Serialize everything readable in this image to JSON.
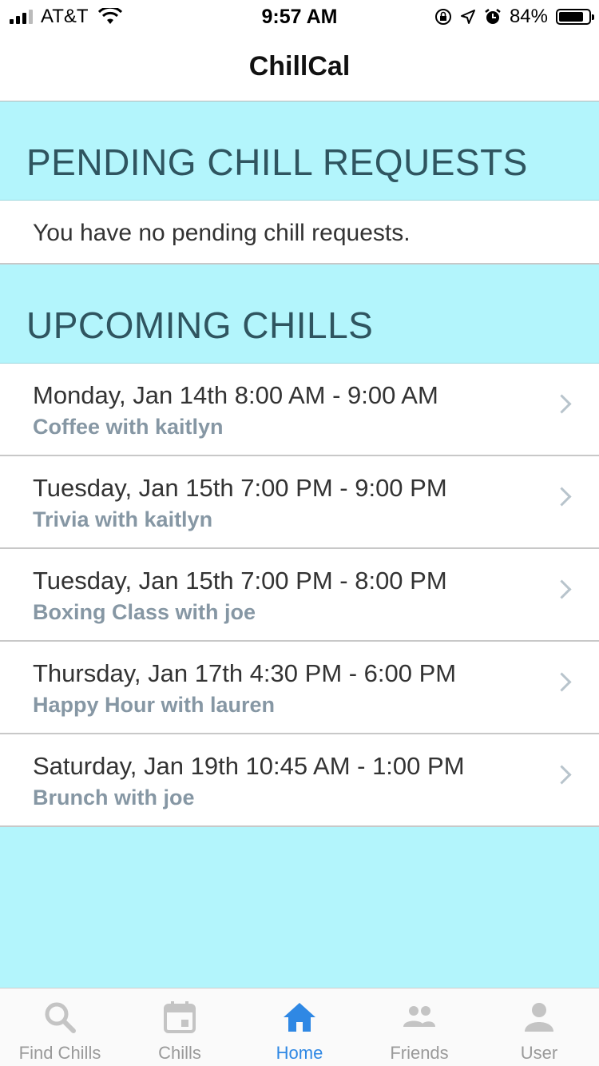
{
  "status": {
    "carrier": "AT&T",
    "time": "9:57 AM",
    "battery": "84%"
  },
  "nav": {
    "title": "ChillCal"
  },
  "pending": {
    "header": "PENDING CHILL REQUESTS",
    "empty_text": "You have no pending chill requests."
  },
  "upcoming": {
    "header": "UPCOMING CHILLS",
    "items": [
      {
        "when": "Monday, Jan 14th 8:00 AM - 9:00 AM",
        "what": "Coffee with kaitlyn"
      },
      {
        "when": "Tuesday, Jan 15th 7:00 PM - 9:00 PM",
        "what": "Trivia with kaitlyn"
      },
      {
        "when": "Tuesday, Jan 15th 7:00 PM - 8:00 PM",
        "what": "Boxing Class with joe"
      },
      {
        "when": "Thursday, Jan 17th 4:30 PM - 6:00 PM",
        "what": "Happy Hour with lauren"
      },
      {
        "when": "Saturday, Jan 19th 10:45 AM - 1:00 PM",
        "what": "Brunch with joe"
      }
    ]
  },
  "tabs": [
    {
      "label": "Find Chills",
      "icon": "search-icon"
    },
    {
      "label": "Chills",
      "icon": "calendar-icon"
    },
    {
      "label": "Home",
      "icon": "home-icon",
      "active": true
    },
    {
      "label": "Friends",
      "icon": "friends-icon"
    },
    {
      "label": "User",
      "icon": "user-icon"
    }
  ],
  "colors": {
    "background": "#b3f5fc",
    "active_tab": "#2f88e4",
    "inactive_tab": "#9a9a9a",
    "subtitle": "#8697a4"
  }
}
